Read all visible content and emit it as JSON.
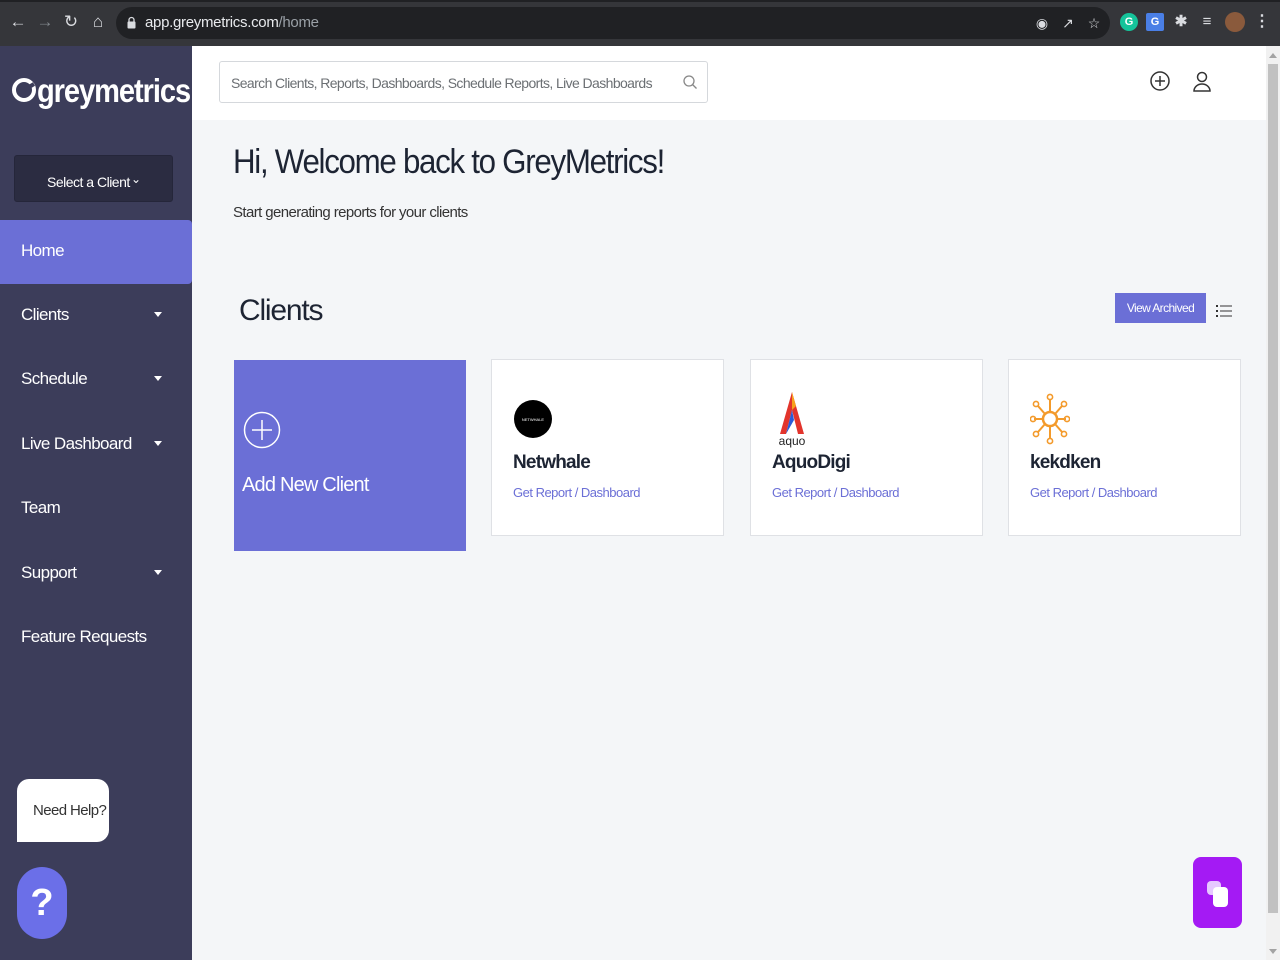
{
  "browser": {
    "url_domain": "app.greymetrics.com",
    "url_path": "/home"
  },
  "sidebar": {
    "logo_text": "greymetrics",
    "client_select_label": "Select a Client",
    "items": [
      {
        "label": "Home",
        "has_caret": false,
        "active": true
      },
      {
        "label": "Clients",
        "has_caret": true
      },
      {
        "label": "Schedule",
        "has_caret": true
      },
      {
        "label": "Live Dashboard",
        "has_caret": true
      },
      {
        "label": "Team",
        "has_caret": false
      },
      {
        "label": "Support",
        "has_caret": true
      },
      {
        "label": "Feature Requests",
        "has_caret": false
      }
    ],
    "need_help_label": "Need Help?",
    "help_button_label": "?"
  },
  "topbar": {
    "search_placeholder": "Search Clients, Reports, Dashboards, Schedule Reports, Live Dashboards"
  },
  "main": {
    "welcome_title": "Hi, Welcome back to GreyMetrics!",
    "welcome_subtitle": "Start generating reports for your clients",
    "clients_heading": "Clients",
    "view_archived_label": "View Archived",
    "add_client_label": "Add New Client",
    "clients": [
      {
        "name": "Netwhale",
        "link": "Get Report / Dashboard",
        "logo_text": "NETWHALE"
      },
      {
        "name": "AquoDigi",
        "link": "Get Report / Dashboard",
        "logo_text": "aquo"
      },
      {
        "name": "kekdken",
        "link": "Get Report / Dashboard"
      }
    ]
  },
  "colors": {
    "accent": "#6b6fd6",
    "sidebar_bg": "#3c3d5a",
    "chat_button": "#a41af4"
  }
}
